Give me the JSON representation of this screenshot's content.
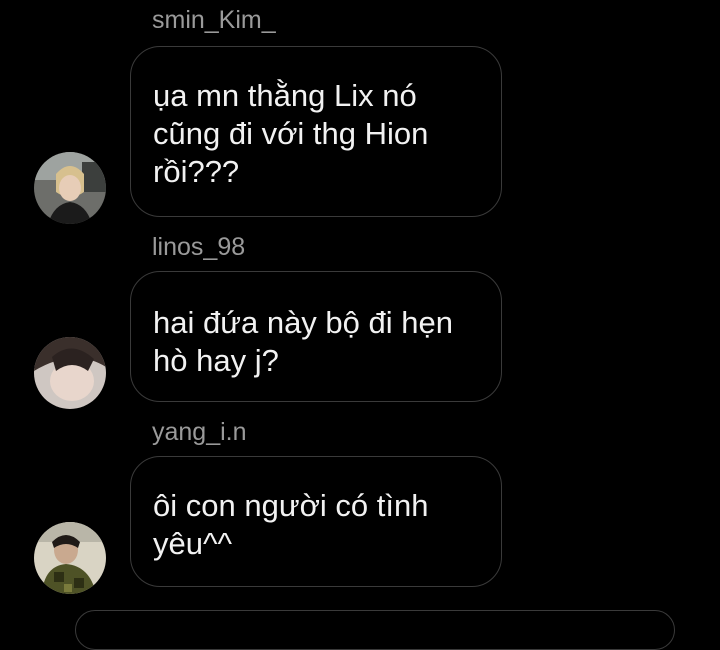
{
  "messages": [
    {
      "sender": "smin_Kim_",
      "text": "ụa mn thằng Lix nó\ncũng đi với thg Hion\nrồi???",
      "avatar_icon": "user-avatar-photo"
    },
    {
      "sender": "linos_98",
      "text": "hai đứa này bộ đi hẹn\nhò hay j?",
      "avatar_icon": "user-avatar-photo"
    },
    {
      "sender": "yang_i.n",
      "text": "ôi con người có tình\nyêu^^",
      "avatar_icon": "user-avatar-photo"
    }
  ],
  "colors": {
    "background": "#000000",
    "bubble_border": "#3a3a3a",
    "sender_text": "#9a9a9a",
    "message_text": "#f2f2f2"
  }
}
